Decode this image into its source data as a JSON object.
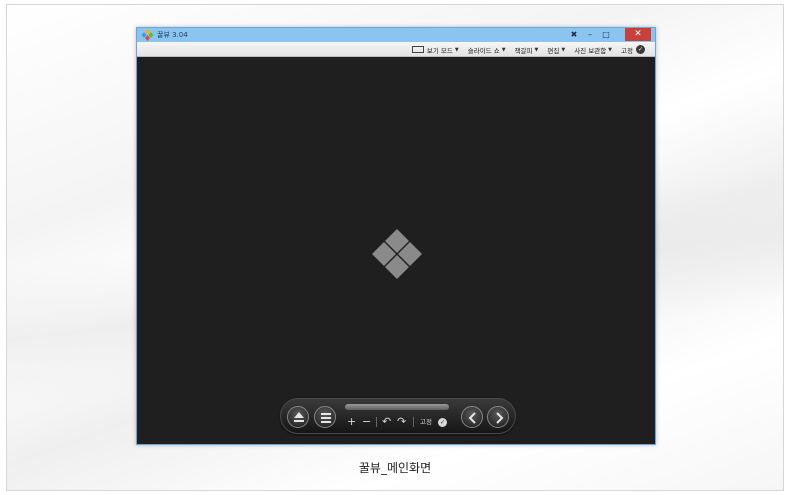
{
  "window": {
    "title": "꿀뷰 3.04",
    "minimize": "–",
    "maximize": "□",
    "close": "✕",
    "pin": "✖"
  },
  "menubar": {
    "items": [
      {
        "label": "보기 모드",
        "has_caret": true
      },
      {
        "label": "슬라이드 쇼",
        "has_caret": true
      },
      {
        "label": "책갈피",
        "has_caret": true
      },
      {
        "label": "편집",
        "has_caret": true
      },
      {
        "label": "사진 보관함",
        "has_caret": true
      },
      {
        "label": "고정",
        "has_caret": false
      }
    ],
    "caret": "▼",
    "check": "✓"
  },
  "controlbar": {
    "zoom_in": "+",
    "zoom_out": "−",
    "rotate_left": "↶",
    "rotate_right": "↷",
    "pin_label": "고정",
    "check": "✓"
  },
  "caption": "꿀뷰_메인화면",
  "colors": {
    "titlebar": "#8cc4f0",
    "close_button": "#c7413a",
    "canvas": "#1f1f1f"
  }
}
